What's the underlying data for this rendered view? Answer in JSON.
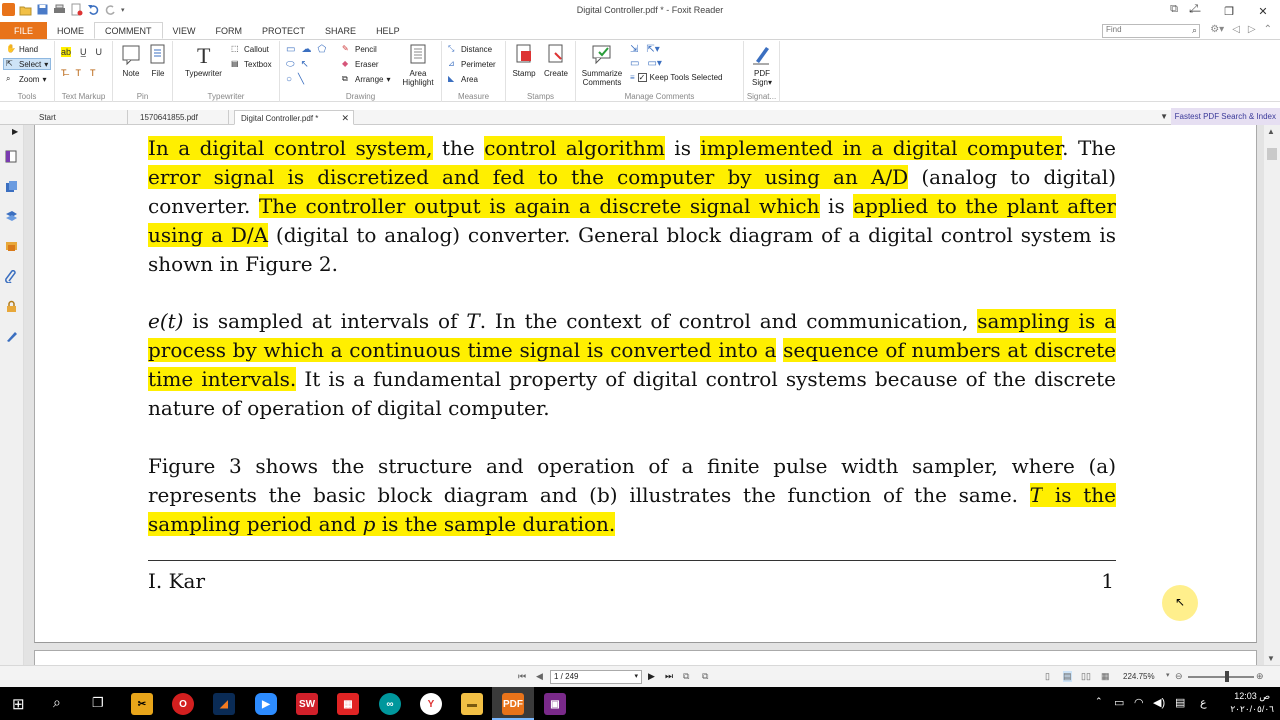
{
  "window": {
    "title": "Digital Controller.pdf * - Foxit Reader",
    "find_placeholder": "Find"
  },
  "ribbon_tabs": [
    "FILE",
    "HOME",
    "COMMENT",
    "VIEW",
    "FORM",
    "PROTECT",
    "SHARE",
    "HELP"
  ],
  "ribbon": {
    "tools": {
      "hand": "Hand",
      "select": "Select",
      "zoom": "Zoom",
      "label": "Tools"
    },
    "text_markup": {
      "label": "Text Markup"
    },
    "pin": {
      "note": "Note",
      "file": "File",
      "label": "Pin"
    },
    "typewriter": {
      "typewriter": "Typewriter",
      "callout": "Callout",
      "textbox": "Textbox",
      "label": "Typewriter"
    },
    "drawing": {
      "pencil": "Pencil",
      "eraser": "Eraser",
      "arrange": "Arrange",
      "area_highlight": "Area Highlight",
      "label": "Drawing"
    },
    "measure": {
      "distance": "Distance",
      "perimeter": "Perimeter",
      "area": "Area",
      "label": "Measure"
    },
    "stamps": {
      "stamp": "Stamp",
      "create": "Create",
      "label": "Stamps"
    },
    "manage": {
      "summarize": "Summarize Comments",
      "keep_tools": "Keep Tools Selected",
      "label": "Manage Comments"
    },
    "signature": {
      "pdf_sign": "PDF Sign",
      "label": "Signat..."
    }
  },
  "doc_tabs": [
    {
      "label": "Start"
    },
    {
      "label": "1570641855.pdf"
    },
    {
      "label": "Digital Controller.pdf *"
    }
  ],
  "fast_search": "Fastest PDF Search & Index",
  "document": {
    "para1": {
      "s1": "In a digital control system,",
      "s2": " the ",
      "s3": "control algorithm",
      "s4": " is ",
      "s5": "implemented in a digital computer",
      "s6": ".  The ",
      "s7": "error signal is discretized and fed to the computer by using an A/D",
      "s8": " (analog to digital) converter. ",
      "s9": "The controller output is again a discrete signal which",
      "s10": " is ",
      "s11": "applied to the plant after using a D/A",
      "s12": " (digital to analog) converter.  General block diagram of a digital control system is shown in Figure 2."
    },
    "para2": {
      "m1": "e(t)",
      "s1": " is sampled at intervals of ",
      "m2": "T",
      "s2": ".  In the context of control and communication, ",
      "s3": "sampling is a process by which a continuous time signal is converted into a",
      "s4": " ",
      "s5": "sequence of numbers at discrete time intervals.",
      "s6": "  It is a fundamental property of digital control systems because of the discrete nature of operation of digital computer."
    },
    "para3": {
      "s1": "Figure 3 shows the structure and operation of a finite pulse width sampler, where (a) represents the basic block diagram and (b) illustrates the function of the same. ",
      "m1": "T",
      "s2": " is the sampling period and ",
      "m2": "p",
      "s3": " is the sample duration."
    },
    "footer_name": "I. Kar",
    "footer_page": "1"
  },
  "status": {
    "page_indicator": "1 / 249",
    "zoom": "224.75%"
  },
  "taskbar": {
    "time": "12:03 ص",
    "date": "٢٠٢٠/٠٥/٠٦",
    "lang": "ع"
  },
  "colors": {
    "highlight": "#ffef00",
    "brand": "#e8731a"
  }
}
